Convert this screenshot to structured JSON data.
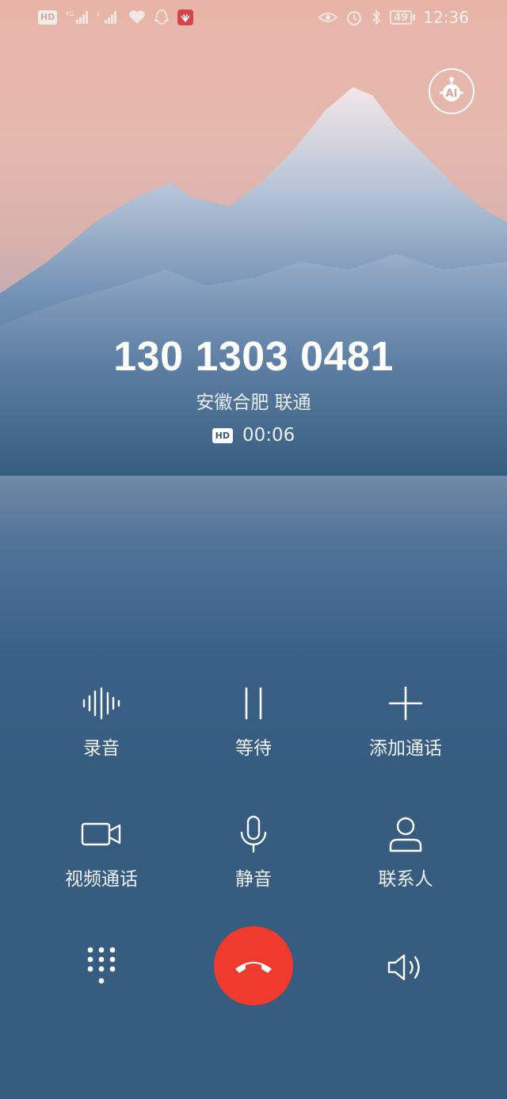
{
  "status_bar": {
    "hd_label": "HD",
    "network_label": "4G",
    "battery_level": "49",
    "time": "12:36",
    "icons": [
      "hd-icon",
      "signal-4g-icon",
      "signal-icon",
      "heart-icon",
      "qq-icon",
      "huawei-icon",
      "eye-icon",
      "alarm-icon",
      "bluetooth-icon",
      "battery-icon"
    ]
  },
  "ai_button": {
    "label": "AI"
  },
  "call": {
    "number": "130 1303 0481",
    "location": "安徽合肥 联通",
    "hd_badge": "HD",
    "duration": "00:06"
  },
  "controls": [
    {
      "label": "录音",
      "icon": "waveform-icon"
    },
    {
      "label": "等待",
      "icon": "pause-icon"
    },
    {
      "label": "添加通话",
      "icon": "plus-icon"
    },
    {
      "label": "视频通话",
      "icon": "video-camera-icon"
    },
    {
      "label": "静音",
      "icon": "microphone-icon"
    },
    {
      "label": "联系人",
      "icon": "person-icon"
    }
  ],
  "bottom": {
    "dialpad_icon": "dialpad-icon",
    "end_call_icon": "end-call-icon",
    "speaker_icon": "speaker-icon",
    "end_call_color": "#ef3b2d"
  },
  "colors": {
    "background": "#365c80",
    "end_call": "#ef3b2d"
  }
}
